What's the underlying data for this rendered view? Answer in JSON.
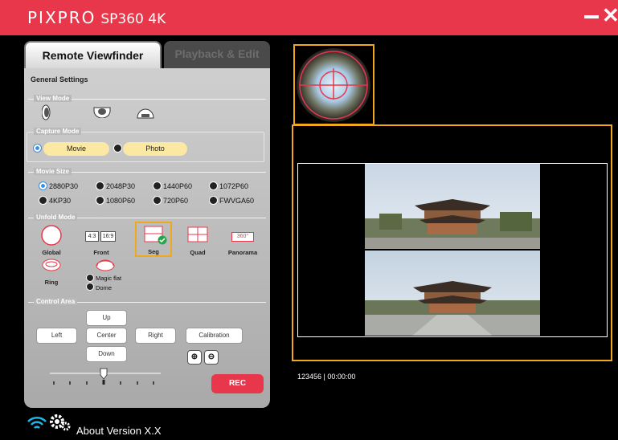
{
  "app": {
    "brand": "PIXPRO",
    "model": "SP360 4K"
  },
  "tabs": [
    {
      "label": "Remote Viewfinder"
    },
    {
      "label": "Playback & Edit"
    }
  ],
  "panel": {
    "title": "General Settings",
    "view_mode": {
      "label": "View Mode"
    },
    "capture_mode": {
      "label": "Capture Mode",
      "options": [
        "Movie",
        "Photo"
      ],
      "selected": "Movie"
    },
    "movie_size": {
      "label": "Movie Size",
      "options": [
        "2880P30",
        "2048P30",
        "1440P60",
        "1072P60",
        "4KP30",
        "1080P60",
        "720P60",
        "FWVGA60"
      ],
      "selected": "2880P30"
    },
    "unfold_mode": {
      "label": "Unfold Mode",
      "options": [
        "Global",
        "Front",
        "Seg",
        "Quad",
        "Panorama",
        "Ring"
      ],
      "front_ratios": [
        "4:3",
        "16:9"
      ],
      "panorama_badge": "360°",
      "dome_options": [
        "Magic flat",
        "Dome"
      ],
      "selected": "Seg"
    },
    "control_area": {
      "label": "Control Area",
      "buttons": {
        "up": "Up",
        "left": "Left",
        "center": "Center",
        "right": "Right",
        "down": "Down",
        "calibration": "Calibration"
      },
      "zoom_in": "⊕",
      "zoom_out": "⊖",
      "rec": "REC"
    }
  },
  "footer": {
    "about": "About Version X.X"
  },
  "status": {
    "text": "123456 | 00:00:00"
  },
  "colors": {
    "accent": "#e8374a",
    "highlight": "#f2a81d",
    "pill": "#fbe8a3",
    "wifi": "#1fb5e8"
  }
}
